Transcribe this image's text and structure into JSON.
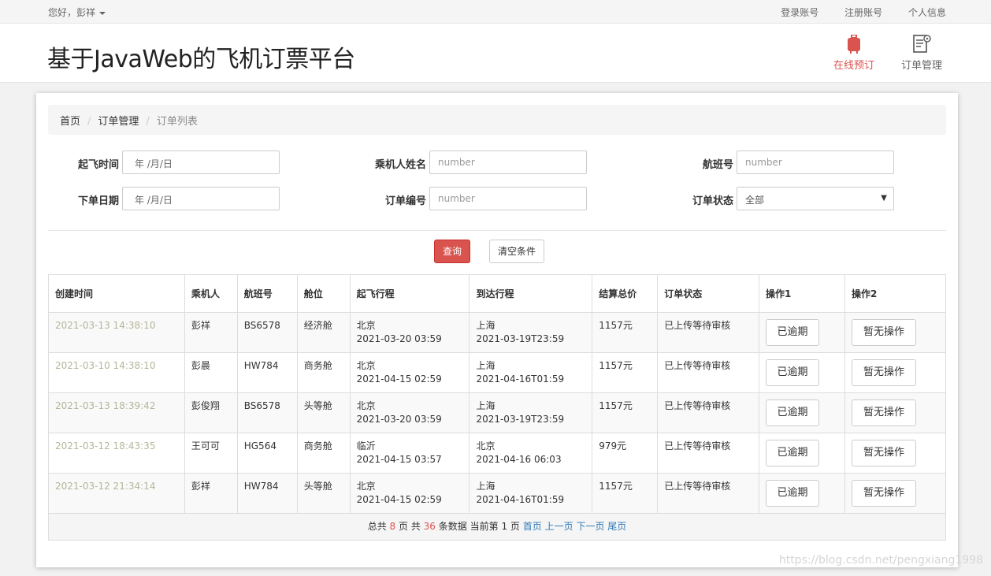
{
  "topbar": {
    "greeting": "您好，彭祥",
    "links": [
      "登录账号",
      "注册账号",
      "个人信息"
    ]
  },
  "header": {
    "title": "基于JavaWeb的飞机订票平台",
    "nav": [
      {
        "label": "在线预订",
        "icon": "luggage-icon",
        "active": true
      },
      {
        "label": "订单管理",
        "icon": "order-manage-icon",
        "active": false
      }
    ]
  },
  "breadcrumb": [
    "首页",
    "订单管理",
    "订单列表"
  ],
  "filters": {
    "departure_time_label": "起飞时间",
    "departure_time_placeholder": "年 /月/日",
    "passenger_name_label": "乘机人姓名",
    "passenger_name_placeholder": "number",
    "flight_no_label": "航班号",
    "flight_no_placeholder": "number",
    "order_date_label": "下单日期",
    "order_date_placeholder": "年 /月/日",
    "order_no_label": "订单编号",
    "order_no_placeholder": "number",
    "order_status_label": "订单状态",
    "order_status_value": "全部"
  },
  "buttons": {
    "query": "查询",
    "clear": "清空条件"
  },
  "table": {
    "headers": [
      "创建时间",
      "乘机人",
      "航班号",
      "舱位",
      "起飞行程",
      "到达行程",
      "结算总价",
      "订单状态",
      "操作1",
      "操作2"
    ],
    "rows": [
      {
        "created": "2021-03-13 14:38:10",
        "passenger": "彭祥",
        "flight": "BS6578",
        "cabin": "经济舱",
        "dep_city": "北京",
        "dep_time": "2021-03-20 03:59",
        "arr_city": "上海",
        "arr_time": "2021-03-19T23:59",
        "price": "1157元",
        "status": "已上传等待审核",
        "op1": "已逾期",
        "op2": "暂无操作"
      },
      {
        "created": "2021-03-10 14:38:10",
        "passenger": "彭晨",
        "flight": "HW784",
        "cabin": "商务舱",
        "dep_city": "北京",
        "dep_time": "2021-04-15 02:59",
        "arr_city": "上海",
        "arr_time": "2021-04-16T01:59",
        "price": "1157元",
        "status": "已上传等待审核",
        "op1": "已逾期",
        "op2": "暂无操作"
      },
      {
        "created": "2021-03-13 18:39:42",
        "passenger": "彭俊翔",
        "flight": "BS6578",
        "cabin": "头等舱",
        "dep_city": "北京",
        "dep_time": "2021-03-20 03:59",
        "arr_city": "上海",
        "arr_time": "2021-03-19T23:59",
        "price": "1157元",
        "status": "已上传等待审核",
        "op1": "已逾期",
        "op2": "暂无操作"
      },
      {
        "created": "2021-03-12 18:43:35",
        "passenger": "王可可",
        "flight": "HG564",
        "cabin": "商务舱",
        "dep_city": "临沂",
        "dep_time": "2021-04-15 03:57",
        "arr_city": "北京",
        "arr_time": "2021-04-16 06:03",
        "price": "979元",
        "status": "已上传等待审核",
        "op1": "已逾期",
        "op2": "暂无操作"
      },
      {
        "created": "2021-03-12 21:34:14",
        "passenger": "彭祥",
        "flight": "HW784",
        "cabin": "头等舱",
        "dep_city": "北京",
        "dep_time": "2021-04-15 02:59",
        "arr_city": "上海",
        "arr_time": "2021-04-16T01:59",
        "price": "1157元",
        "status": "已上传等待审核",
        "op1": "已逾期",
        "op2": "暂无操作"
      }
    ]
  },
  "pager": {
    "text_total_prefix": "总共",
    "total_pages": "8",
    "text_pages_mid": "页 共",
    "total_records": "36",
    "text_records_mid": "条数据 当前第",
    "current_page": "1",
    "text_page_suffix": "页",
    "first": "首页",
    "prev": "上一页",
    "next": "下一页",
    "last": "尾页"
  },
  "watermark": "https://blog.csdn.net/pengxiang1998",
  "colors": {
    "accent": "#d9534f",
    "link": "#337ab7"
  }
}
